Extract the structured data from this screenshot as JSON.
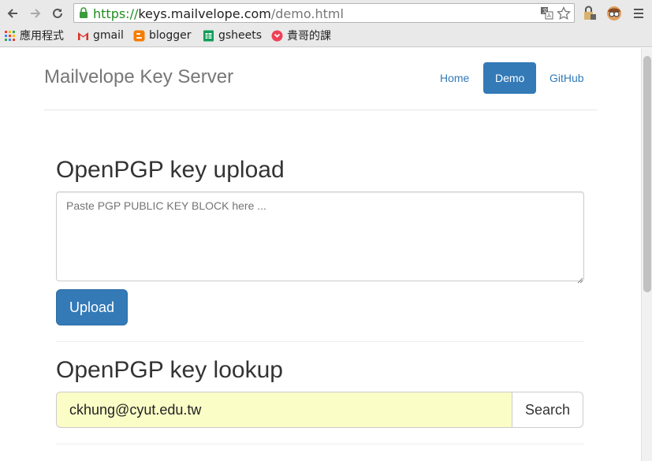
{
  "browser": {
    "url_scheme": "https://",
    "url_host": "keys.mailvelope.com",
    "url_path": "/demo.html",
    "bookmarks": [
      {
        "label": "應用程式",
        "icon": "apps-grid-icon"
      },
      {
        "label": "gmail",
        "icon": "gmail-icon"
      },
      {
        "label": "blogger",
        "icon": "blogger-icon"
      },
      {
        "label": "gsheets",
        "icon": "sheets-icon"
      },
      {
        "label": "貴哥的課",
        "icon": "pocket-icon"
      }
    ]
  },
  "header": {
    "brand": "Mailvelope Key Server",
    "nav": [
      {
        "label": "Home",
        "active": false
      },
      {
        "label": "Demo",
        "active": true
      },
      {
        "label": "GitHub",
        "active": false
      }
    ]
  },
  "upload": {
    "title": "OpenPGP key upload",
    "placeholder": "Paste PGP PUBLIC KEY BLOCK here ...",
    "button_label": "Upload"
  },
  "lookup": {
    "title": "OpenPGP key lookup",
    "value": "ckhung@cyut.edu.tw",
    "button_label": "Search"
  },
  "colors": {
    "primary": "#337ab7",
    "input_fill": "#fbfdc7",
    "url_secure": "#1e8e1e"
  }
}
